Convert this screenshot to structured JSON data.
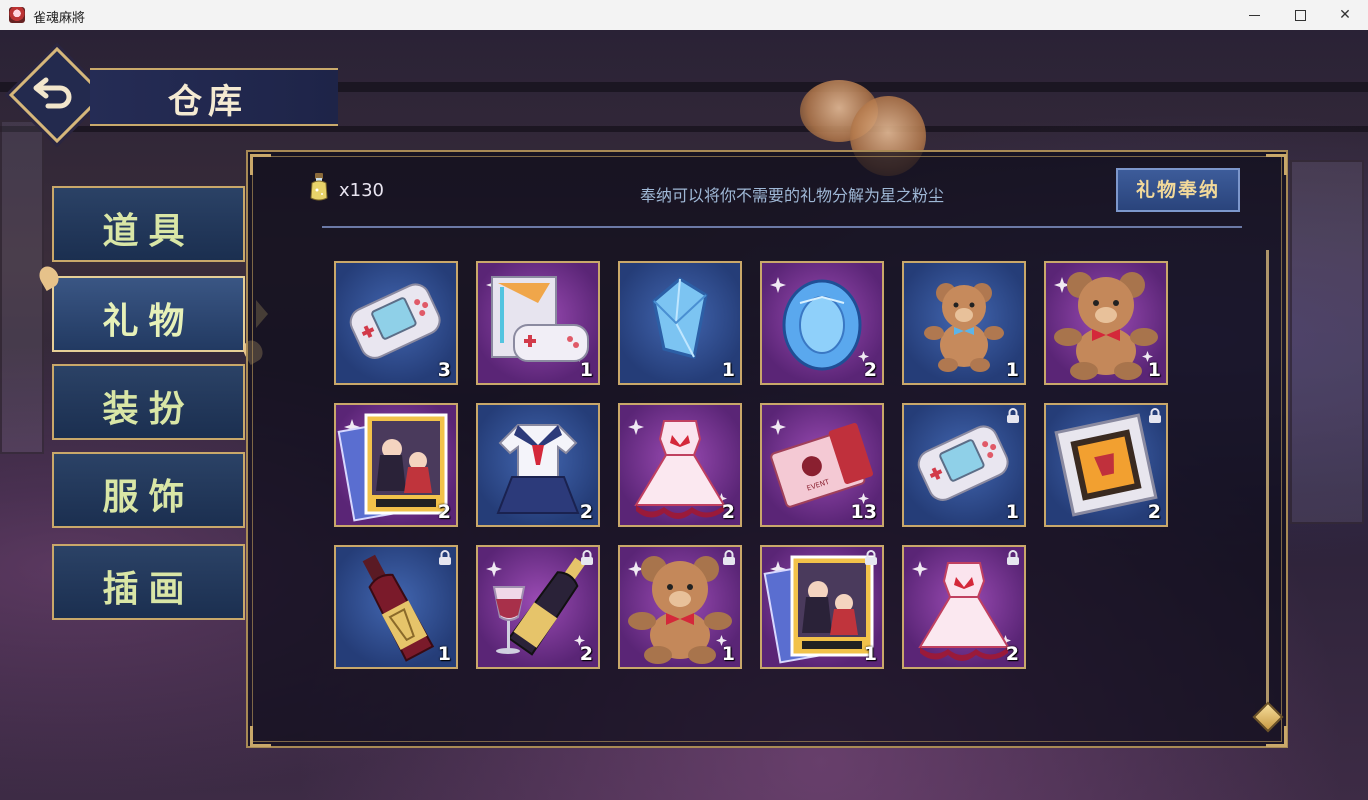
{
  "window": {
    "title": "雀魂麻將"
  },
  "header": {
    "title": "仓库"
  },
  "tabs": [
    {
      "label": "道具",
      "active": false
    },
    {
      "label": "礼物",
      "active": true
    },
    {
      "label": "装扮",
      "active": false
    },
    {
      "label": "服饰",
      "active": false
    },
    {
      "label": "插画",
      "active": false
    }
  ],
  "toolbar": {
    "dust_count": "x130",
    "hint": "奉纳可以将你不需要的礼物分解为星之粉尘",
    "gift_button": "礼物奉纳"
  },
  "items": [
    {
      "icon": "game-console-icon",
      "rarity": "blue",
      "qty": "3",
      "locked": false
    },
    {
      "icon": "game-console-box-icon",
      "rarity": "purple",
      "qty": "1",
      "locked": false
    },
    {
      "icon": "crystal-icon",
      "rarity": "blue",
      "qty": "1",
      "locked": false
    },
    {
      "icon": "gem-icon",
      "rarity": "purple",
      "qty": "2",
      "locked": false
    },
    {
      "icon": "teddy-bear-small-icon",
      "rarity": "blue",
      "qty": "1",
      "locked": false
    },
    {
      "icon": "teddy-bear-icon",
      "rarity": "purple",
      "qty": "1",
      "locked": false
    },
    {
      "icon": "photo-cards-icon",
      "rarity": "purple",
      "qty": "2",
      "locked": false
    },
    {
      "icon": "school-uniform-icon",
      "rarity": "blue",
      "qty": "2",
      "locked": false
    },
    {
      "icon": "dress-icon",
      "rarity": "purple",
      "qty": "2",
      "locked": false
    },
    {
      "icon": "ticket-icon",
      "rarity": "purple",
      "qty": "13",
      "locked": false
    },
    {
      "icon": "game-console-icon",
      "rarity": "blue",
      "qty": "1",
      "locked": true
    },
    {
      "icon": "picture-frame-icon",
      "rarity": "blue",
      "qty": "2",
      "locked": true
    },
    {
      "icon": "wine-bottle-icon",
      "rarity": "blue",
      "qty": "1",
      "locked": true
    },
    {
      "icon": "champagne-icon",
      "rarity": "purple",
      "qty": "2",
      "locked": true
    },
    {
      "icon": "teddy-bear-icon",
      "rarity": "purple",
      "qty": "1",
      "locked": true
    },
    {
      "icon": "photo-cards-icon",
      "rarity": "purple",
      "qty": "1",
      "locked": true
    },
    {
      "icon": "dress-icon",
      "rarity": "purple",
      "qty": "2",
      "locked": true
    }
  ]
}
